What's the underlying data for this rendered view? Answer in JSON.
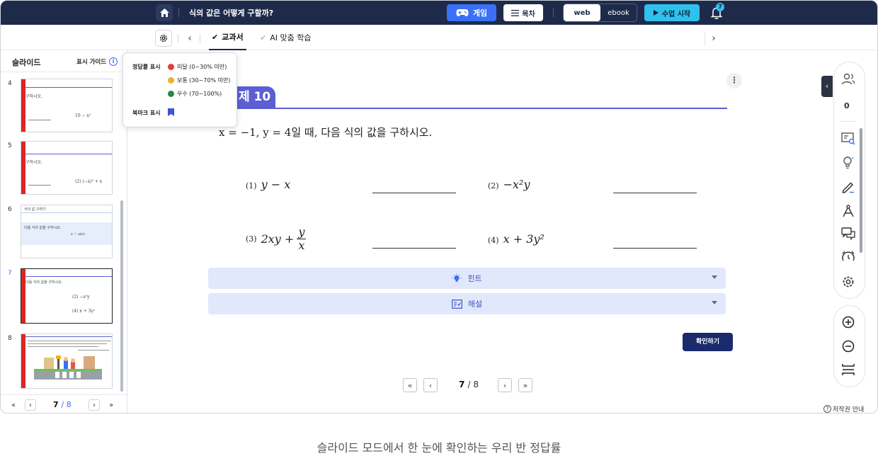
{
  "topbar": {
    "title": "식의 값은 어떻게 구할까?",
    "game_label": "게임",
    "toc_label": "목차",
    "mode_web": "web",
    "mode_ebook": "ebook",
    "start_label": "수업 시작",
    "notification_count": "7",
    "colors": {
      "bar": "#1e2a4a",
      "game": "#3a6ff7",
      "start": "#2fc1ee"
    }
  },
  "subbar": {
    "tab_textbook": "교과서",
    "tab_ai": "AI 맞춤 학습"
  },
  "sidebar": {
    "title": "슬라이드",
    "guide_label": "표시 가이드",
    "slides": [
      {
        "num": "4",
        "t1": "구하시오.",
        "t2": "10 − x²"
      },
      {
        "num": "5",
        "t1": "구하시오.",
        "t2": "(2)  (−x)³ + x"
      },
      {
        "num": "6",
        "t1": "식의 값 구하기",
        "t2": "다음 식의 값을 구하시오.",
        "t3": "x = ab/c"
      },
      {
        "num": "7",
        "t1": "다음 식의 값을 구하시오.",
        "t2": "(2)  −x²y",
        "t3": "(4)  x + 3y²"
      },
      {
        "num": "8",
        "t1": "",
        "t2": ""
      }
    ],
    "current_page": "7",
    "total_pages": "/ 8"
  },
  "popup": {
    "accuracy_label": "정답률 표시",
    "levels": [
      {
        "label": "미달 (0~30% 미만)",
        "color": "#e53b3b"
      },
      {
        "label": "보통 (30~70% 미만)",
        "color": "#f2b01e"
      },
      {
        "label": "우수 (70~100%)",
        "color": "#1f8a4c"
      }
    ],
    "bookmark_label": "북마크 표시",
    "bookmark_color": "#3a55d6"
  },
  "main": {
    "question_tab": "제 10",
    "question_text": "x = −1, y = 4일 때, 다음 식의 값을 구하시오.",
    "problems": {
      "p1_num": "(1)",
      "p1_expr": "y − x",
      "p2_num": "(2)",
      "p2_expr": "−x²y",
      "p3_num": "(3)",
      "p3_expr": "2xy +",
      "p3_frac_n": "y",
      "p3_frac_d": "x",
      "p4_num": "(4)",
      "p4_expr": "x + 3y²"
    },
    "hint_label": "힌트",
    "solution_label": "해설",
    "check_label": "확인하기",
    "current_page": "7",
    "total_pages": "/ 8",
    "accent_color": "#5b5fd1"
  },
  "right_panel": {
    "count": "0",
    "copyright_label": "저작권 안내"
  },
  "caption": "슬라이드 모드에서 한 눈에 확인하는 우리 반 정답률"
}
